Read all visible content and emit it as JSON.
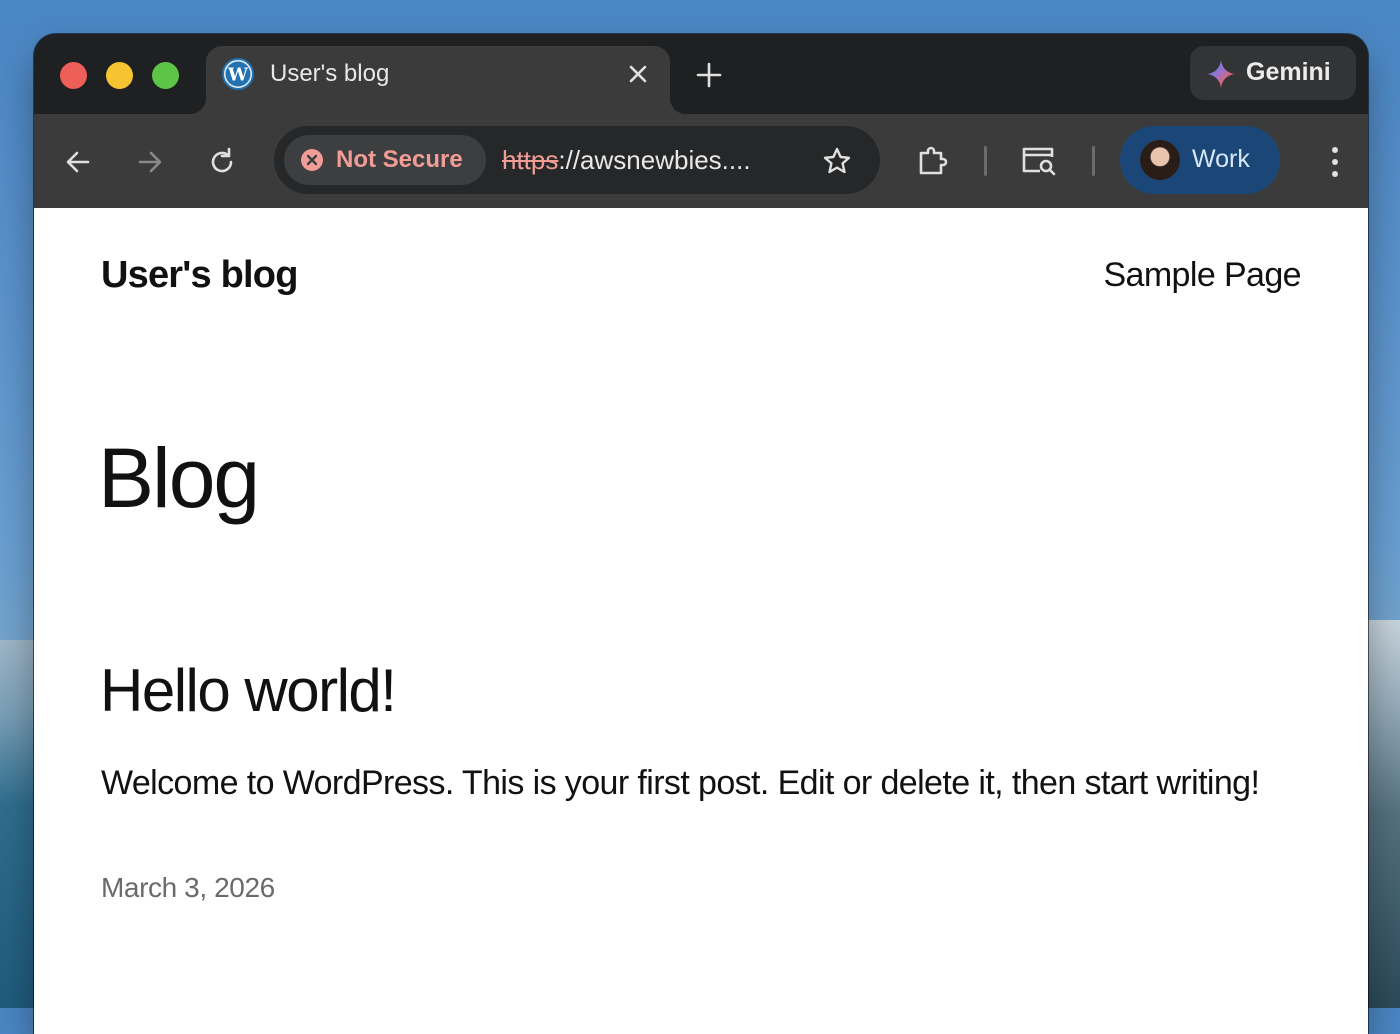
{
  "browser": {
    "tab": {
      "title": "User's blog",
      "favicon": "wordpress-icon"
    },
    "gemini_label": "Gemini",
    "security_chip": "Not Secure",
    "url": {
      "scheme": "https",
      "rest": "://awsnewbies...."
    },
    "profile_label": "Work",
    "colors": {
      "profile_bg": "#1a4778",
      "not_secure": "#f19d96"
    }
  },
  "site": {
    "title": "User's blog",
    "nav": [
      "Sample Page"
    ]
  },
  "main": {
    "heading": "Blog",
    "posts": [
      {
        "title": "Hello world!",
        "excerpt": "Welcome to WordPress. This is your first post. Edit or delete it, then start writing!",
        "date": "March 3, 2026"
      }
    ]
  }
}
